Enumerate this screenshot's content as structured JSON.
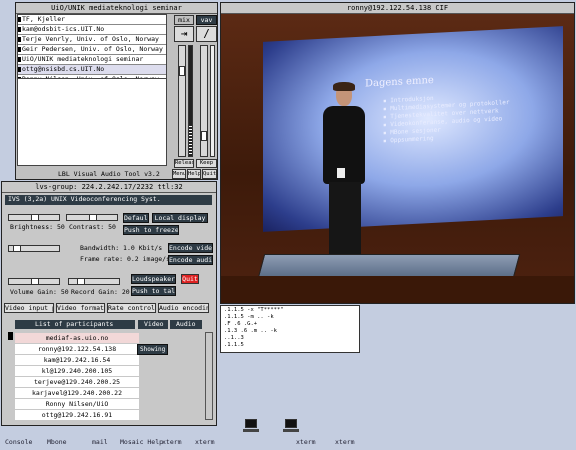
{
  "vat_window": {
    "title": "UiO/UNIK mediateknologi seminar",
    "mic_label": "mix",
    "spk_label": "vav",
    "sites": [
      {
        "name": "TF, Kjeller",
        "selected": false
      },
      {
        "name": "kam@odsbit-ics.UIT.No",
        "selected": false
      },
      {
        "name": "Terje Venrly, Univ. of Oslo, Norway",
        "selected": false
      },
      {
        "name": "Geir Pedersen, Univ. of Oslo, Norway",
        "selected": false
      },
      {
        "name": "UiO/UNIK mediateknologi seminar",
        "selected": false
      },
      {
        "name": "ottg@nsisbd.cs.UIT.No",
        "selected": true
      },
      {
        "name": "Ronny Nilsen, Univ. of Oslo, Norway",
        "selected": false
      }
    ],
    "release_label": "Release",
    "keep_label": "Keep",
    "status": "LBL Visual Audio Tool v3.2",
    "menu_label": "Menu",
    "help_label": "Help",
    "quit_label": "Quit"
  },
  "video_window": {
    "title": "ronny@192.122.54.138 CIF",
    "slide_title": "Dagens emne",
    "slide_bullets": [
      "Introduksjon",
      "Multimediasystemer og protokoller",
      "Tjenestekvalitet over nettverk",
      "Videokonferanse, audio og video",
      "MBone sesjoner",
      "Oppsummering"
    ]
  },
  "vic_window": {
    "title": "lvs-group: 224.2.242.17/2232  ttl:32",
    "header": "IVS (3,2a) UNIX Videoconferencing Syst.",
    "brightness_label": "Brightness: 50",
    "contrast_label": "Contrast: 50",
    "default_label": "Default",
    "local_display_label": "Local display",
    "push_freeze_label": "Push to freeze",
    "bandwidth_label": "Bandwidth: 1.0 Kbit/s",
    "frame_rate_label": "Frame rate: 0.2 image/s",
    "encode_video_label": "Encode video",
    "encode_audio_label": "Encode audio",
    "volume_label": "Volume Gain: 50",
    "record_label": "Record Gain: 20",
    "loudspeaker_label": "Loudspeaker",
    "quit_label": "Quit",
    "push_talk_label": "Push to talk",
    "tabs": [
      "Video input port",
      "Video format",
      "Rate control",
      "Audio encoding"
    ],
    "participants_header": "List of participants",
    "video_header": "Video",
    "audio_header": "Audio",
    "participants": [
      {
        "name": "mediaf-as.uio.no",
        "highlight": true,
        "badge": ""
      },
      {
        "name": "ronny@192.122.54.138",
        "highlight": false,
        "badge": "Showing"
      },
      {
        "name": "kam@129.242.16.54",
        "highlight": false,
        "badge": ""
      },
      {
        "name": "kl@129.240.200.105",
        "highlight": false,
        "badge": ""
      },
      {
        "name": "terjeve@129.240.200.25",
        "highlight": false,
        "badge": ""
      },
      {
        "name": "karjavel@129.240.200.22",
        "highlight": false,
        "badge": ""
      },
      {
        "name": "Ronny Nilsen/UiO",
        "highlight": false,
        "badge": ""
      },
      {
        "name": "ottg@129.242.16.91",
        "highlight": false,
        "badge": ""
      }
    ]
  },
  "terminal_window": {
    "lines": [
      ".1.1.5 -x \"T*****\"",
      ".1.1.5 -m .. -k",
      ".F .6 .G.+",
      ".1.3 .6 .m .. -k",
      "..1..3",
      ".1.1.5"
    ]
  },
  "desktop": {
    "icons": [
      "Console",
      "Mbone",
      "mail",
      "Mosaic Help",
      "xterm",
      "xterm",
      "",
      "",
      "xterm",
      "xterm"
    ]
  }
}
